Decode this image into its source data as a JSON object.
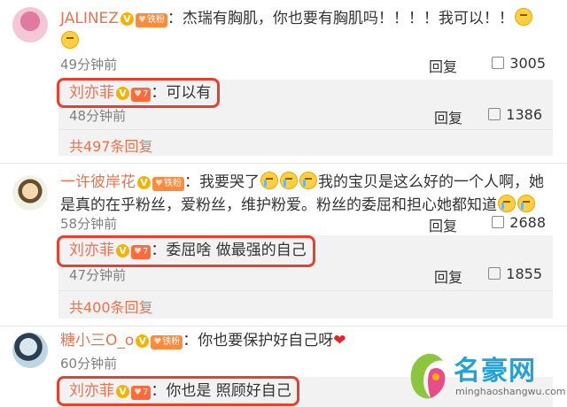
{
  "comments": [
    {
      "username": "JALINEZ",
      "badge_v": "V",
      "badge_fan": "铁粉",
      "text": "：杰瑞有胸肌，你也要有胸肌吗！！！！我可以！！",
      "time": "49分钟前",
      "reply_label": "回复",
      "likes": "3005",
      "reply": {
        "username": "刘亦菲",
        "text": "：可以有",
        "time": "48分钟前",
        "reply_label": "回复",
        "likes": "1386"
      },
      "more": "共497条回复"
    },
    {
      "username": "一许彼岸花",
      "badge_v": "V",
      "badge_fan": "铁粉",
      "text_a": "：我要哭了",
      "text_b": "我的宝贝是这么好的一个人啊，她是真的在乎粉丝，爱粉丝，维护粉爱。粉丝的委屈和担心她都知道",
      "time": "58分钟前",
      "reply_label": "回复",
      "likes": "2688",
      "reply": {
        "username": "刘亦菲",
        "text": "：委屈啥 做最强的自己",
        "time": "47分钟前",
        "reply_label": "回复",
        "likes": "1855"
      },
      "more": "共400条回复"
    },
    {
      "username": "糖小三O_o",
      "badge_v": "V",
      "badge_fan": "铁粉",
      "text": "：你也要保护好自己呀",
      "heart": "❤",
      "time": "60分钟前",
      "reply": {
        "username": "刘亦菲",
        "text": "：你也是 照顾好自己"
      }
    }
  ],
  "watermark": {
    "title": "名豪网",
    "url": "minghaoshangwu.com"
  },
  "colors": {
    "username": "#eb7350",
    "highlight": "#e8402e",
    "reply_bg": "#f2f2f2",
    "watermark": "#23a2d5"
  }
}
